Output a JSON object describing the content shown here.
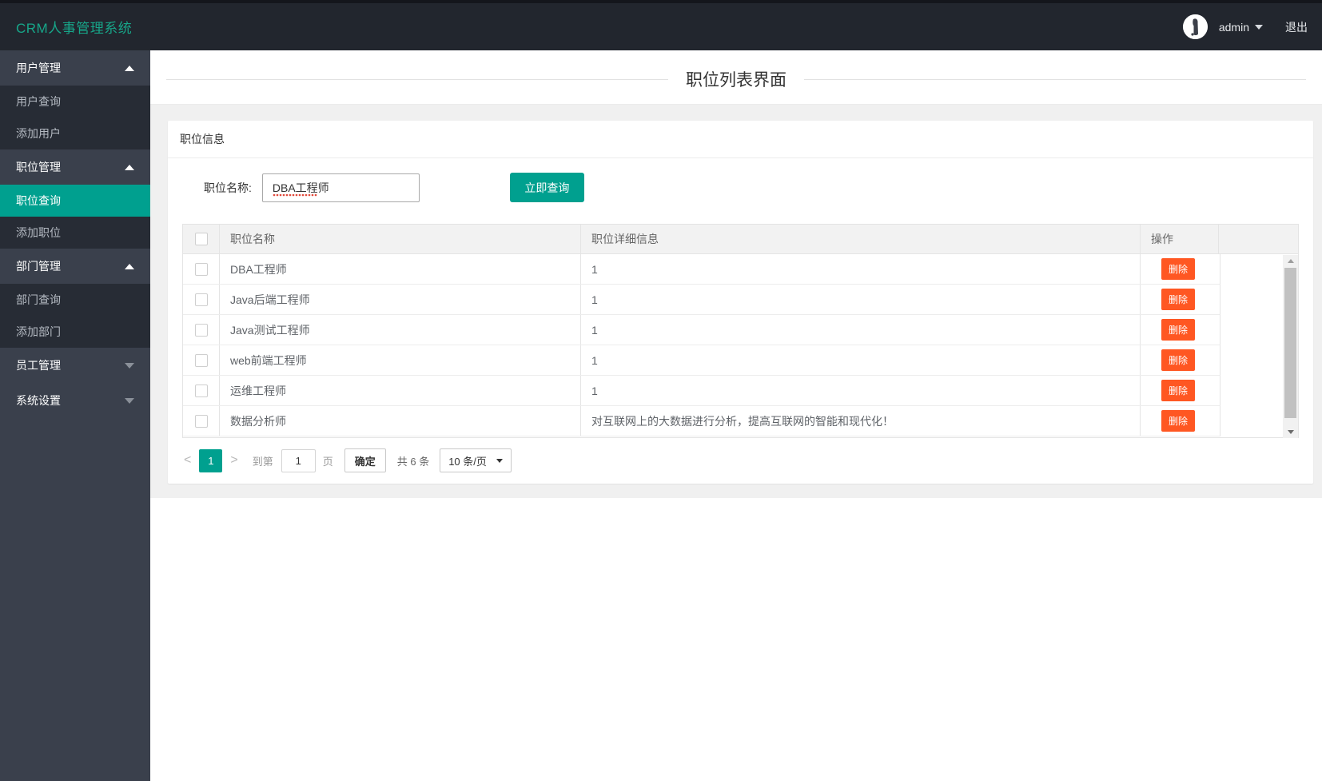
{
  "header": {
    "brand": "CRM人事管理系统",
    "username": "admin",
    "logout_label": "退出"
  },
  "sidebar": {
    "groups": [
      {
        "label": "用户管理",
        "state": "expanded",
        "items": [
          {
            "label": "用户查询"
          },
          {
            "label": "添加用户"
          }
        ]
      },
      {
        "label": "职位管理",
        "state": "expanded",
        "items": [
          {
            "label": "职位查询",
            "active": true
          },
          {
            "label": "添加职位"
          }
        ]
      },
      {
        "label": "部门管理",
        "state": "expanded",
        "items": [
          {
            "label": "部门查询"
          },
          {
            "label": "添加部门"
          }
        ]
      },
      {
        "label": "员工管理",
        "state": "collapsed",
        "items": []
      },
      {
        "label": "系统设置",
        "state": "collapsed",
        "items": []
      }
    ]
  },
  "page": {
    "title": "职位列表界面"
  },
  "panel": {
    "title": "职位信息",
    "form": {
      "name_label": "职位名称:",
      "name_value": "DBA工程师",
      "search_button": "立即查询"
    }
  },
  "table": {
    "columns": [
      "职位名称",
      "职位详细信息",
      "操作"
    ],
    "delete_label": "删除",
    "rows": [
      {
        "name": "DBA工程师",
        "detail": "1"
      },
      {
        "name": "Java后端工程师",
        "detail": "1"
      },
      {
        "name": "Java测试工程师",
        "detail": "1"
      },
      {
        "name": "web前端工程师",
        "detail": "1"
      },
      {
        "name": "运维工程师",
        "detail": "1"
      },
      {
        "name": "数据分析师",
        "detail": "对互联网上的大数据进行分析，提高互联网的智能和现代化！"
      }
    ]
  },
  "pagination": {
    "current_page": "1",
    "goto_label": "到第",
    "goto_value": "1",
    "page_word": "页",
    "confirm_button": "确定",
    "total_text": "共 6 条",
    "page_size": "10 条/页"
  },
  "colors": {
    "accent": "#00a08f",
    "danger": "#ff5722",
    "brand_text": "#17a689",
    "header_bg": "#22262e",
    "sidebar_bg": "#3a404c",
    "sidebar_submenu_bg": "#272c35",
    "content_bg": "#f0f0f0"
  }
}
